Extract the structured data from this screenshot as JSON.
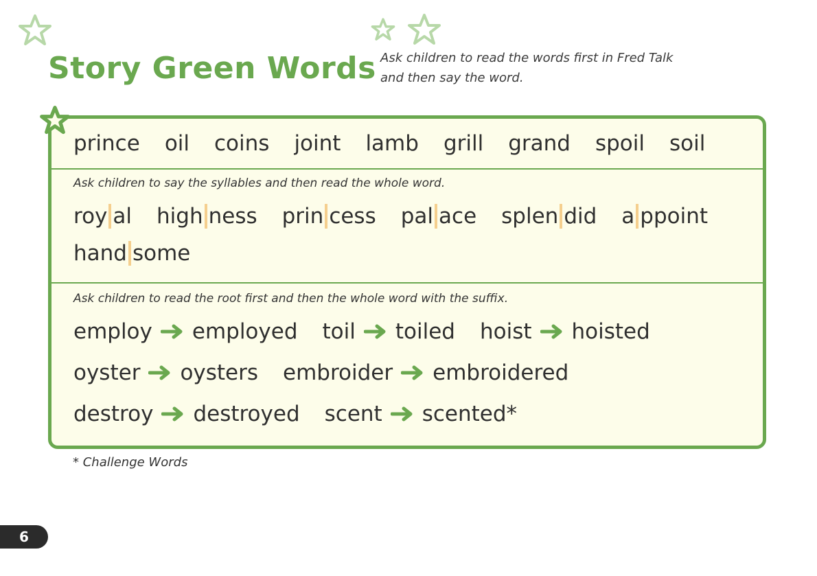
{
  "title": "Story Green Words",
  "intro_text": "Ask children to read the words first in Fred Talk and then say the word.",
  "section1": {
    "words": [
      "prince",
      "oil",
      "coins",
      "joint",
      "lamb",
      "grill",
      "grand",
      "spoil",
      "soil"
    ]
  },
  "section2": {
    "instruction": "Ask children to say the syllables and then read the whole word.",
    "line1": [
      {
        "a": "roy",
        "b": "al"
      },
      {
        "a": "high",
        "b": "ness"
      },
      {
        "a": "prin",
        "b": "cess"
      },
      {
        "a": "pal",
        "b": "ace"
      },
      {
        "a": "splen",
        "b": "did"
      },
      {
        "a": "a",
        "b": "ppoint"
      }
    ],
    "line2": [
      {
        "a": "hand",
        "b": "some"
      }
    ]
  },
  "section3": {
    "instruction": "Ask children to read the root first and then the whole word with the suffix.",
    "line1": [
      {
        "root": "employ",
        "word": "employed"
      },
      {
        "root": "toil",
        "word": "toiled"
      },
      {
        "root": "hoist",
        "word": "hoisted"
      }
    ],
    "line2": [
      {
        "root": "oyster",
        "word": "oysters"
      },
      {
        "root": "embroider",
        "word": "embroidered"
      }
    ],
    "line3": [
      {
        "root": "destroy",
        "word": "destroyed"
      },
      {
        "root": "scent",
        "word": "scented*"
      }
    ]
  },
  "footnote": "* Challenge Words",
  "page_number": "6",
  "colors": {
    "green": "#6aa84f",
    "panel_bg": "#fdfdea",
    "syllable_bar": "#f5cf8e",
    "light_star": "#b7d8a8"
  },
  "icons": [
    "star-outline-icon",
    "arrow-right-icon"
  ]
}
